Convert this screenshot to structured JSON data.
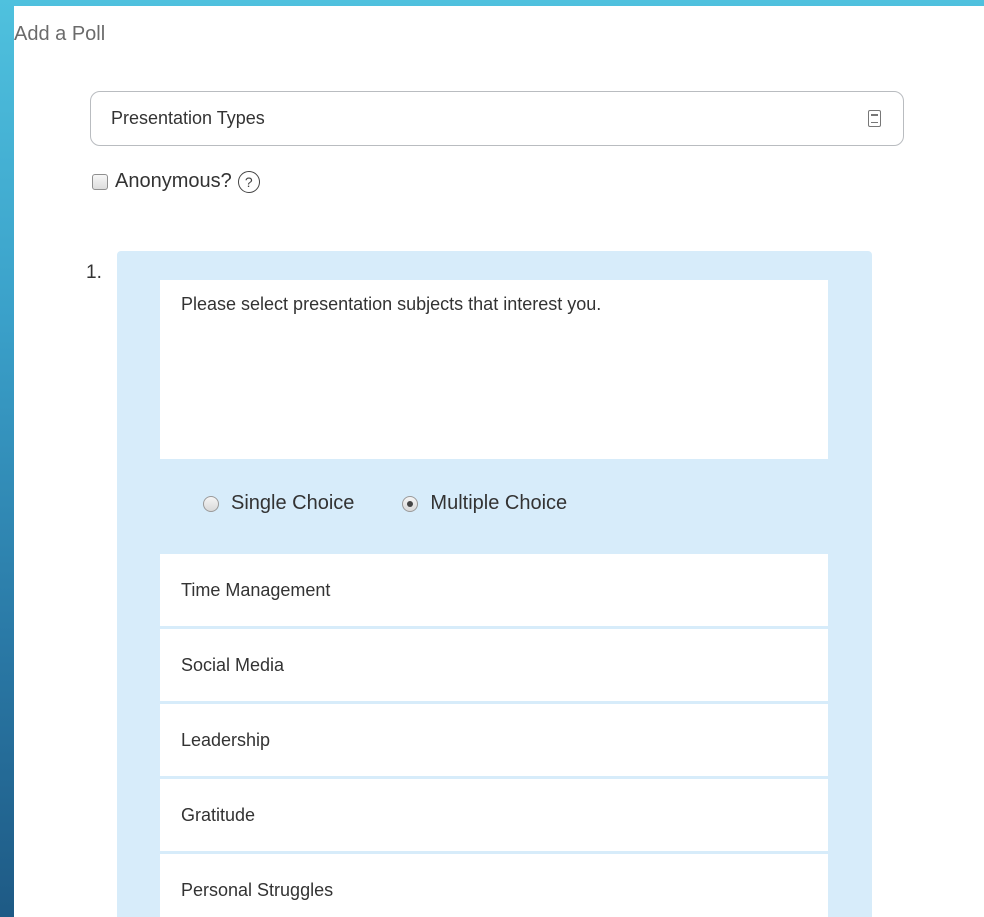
{
  "window": {
    "title": "Add a Poll"
  },
  "poll": {
    "title_value": "Presentation Types",
    "anonymous_label": "Anonymous?",
    "anonymous_checked": false,
    "help_glyph": "?"
  },
  "question": {
    "number": "1.",
    "text": "Please select presentation subjects that interest you.",
    "types": [
      {
        "label": "Single Choice",
        "selected": false
      },
      {
        "label": "Multiple Choice",
        "selected": true
      }
    ],
    "answers": [
      "Time Management",
      "Social Media",
      "Leadership",
      "Gratitude",
      "Personal Struggles"
    ]
  },
  "icons": {
    "title_field_icon": "document-icon",
    "help_icon": "help-circle-icon"
  },
  "colors": {
    "background_top": "#4fc1de",
    "background_bottom": "#1e5a85",
    "card_bg": "#d7ecfa"
  }
}
